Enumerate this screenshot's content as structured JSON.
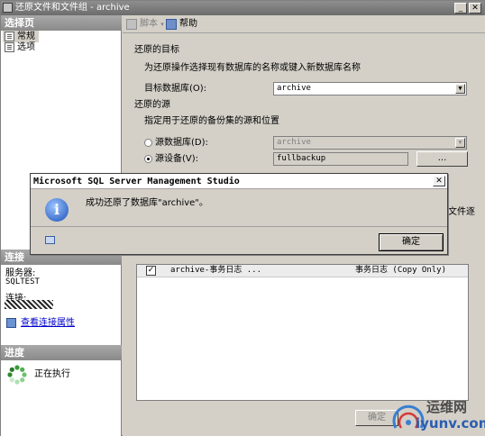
{
  "window": {
    "title": "还原文件和文件组 - archive"
  },
  "left_panel": {
    "select_page_header": "选择页",
    "pages": [
      {
        "label": "常规",
        "selected": true
      },
      {
        "label": "选项",
        "selected": false
      }
    ],
    "connection_header": "连接",
    "server_label": "服务器:",
    "server_value": "SQLTEST",
    "connection_label": "连接:",
    "view_properties_link": "查看连接属性",
    "progress_header": "进度",
    "progress_status": "正在执行"
  },
  "toolbar": {
    "script_label": "脚本",
    "help_label": "帮助"
  },
  "restore_target": {
    "section_label": "还原的目标",
    "description": "为还原操作选择现有数据库的名称或键入新数据库名称",
    "target_db_label": "目标数据库(O):",
    "target_db_value": "archive"
  },
  "restore_source": {
    "section_label": "还原的源",
    "description": "指定用于还原的备份集的源和位置",
    "source_db_label": "源数据库(D):",
    "source_db_value": "archive",
    "source_device_label": "源设备(V):",
    "source_device_value": "fullbackup",
    "browse_button": "..."
  },
  "backup_grid": {
    "partial_header": "文件逐",
    "rows": [
      {
        "name": "archive-事务日志 ...",
        "type": "事务日志 (Copy Only)",
        "checked": true
      }
    ]
  },
  "dialog": {
    "title": "Microsoft SQL Server Management Studio",
    "message": "成功还原了数据库\"archive\"。",
    "ok_button": "确定",
    "icon": "info-icon"
  },
  "footer": {
    "ok_button": "确定"
  },
  "watermark": {
    "text": "运维网",
    "sub": "iyunv.com"
  }
}
